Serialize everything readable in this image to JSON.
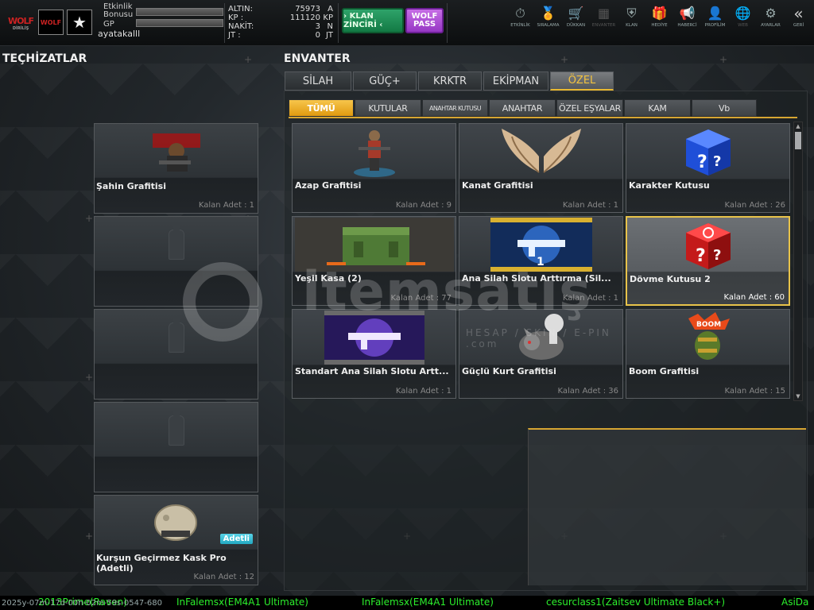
{
  "topbar": {
    "logo_text": "WOLF",
    "logo_sub": "DİRİLİŞ",
    "rank_badge_text": "WOLF",
    "etkinlik_label": "Etkinlik",
    "bonusu_label": "Bonusu",
    "gp_label": "GP",
    "username": "ayatakalll",
    "currency": [
      {
        "label": "ALTIN:",
        "value": "75973",
        "unit": "A"
      },
      {
        "label": "KP   :",
        "value": "111120",
        "unit": "KP"
      },
      {
        "label": "NAKİT:",
        "value": "3",
        "unit": "N"
      },
      {
        "label": "JT   :",
        "value": "0",
        "unit": "JT"
      }
    ],
    "klan_button": "› KLAN ZİNCİRİ ‹",
    "wolf_pass_line1": "WOLF",
    "wolf_pass_line2": "PASS",
    "nav": [
      {
        "label": "ETKİNLİK",
        "icon": "⏱"
      },
      {
        "label": "SIRALAMA",
        "icon": "🏅"
      },
      {
        "label": "DÜKKAN",
        "icon": "🛒"
      },
      {
        "label": "ENVANTER",
        "icon": "▦"
      },
      {
        "label": "KLAN",
        "icon": "⛨"
      },
      {
        "label": "HEDİYE",
        "icon": "🎁"
      },
      {
        "label": "HABERCİ",
        "icon": "📢"
      },
      {
        "label": "PROFİLİM",
        "icon": "👤"
      },
      {
        "label": "WEB",
        "icon": "🌐"
      },
      {
        "label": "AYARLAR",
        "icon": "⚙"
      },
      {
        "label": "GERİ",
        "icon": "«"
      }
    ]
  },
  "left_panel": {
    "title": "TEÇHİZATLAR",
    "slots": [
      {
        "name": "Şahin Grafitisi",
        "count": "Kalan Adet : 1",
        "filled": true
      },
      {
        "name": "",
        "count": "",
        "filled": false
      },
      {
        "name": "",
        "count": "",
        "filled": false
      },
      {
        "name": "",
        "count": "",
        "filled": false
      },
      {
        "name": "Kurşun Geçirmez Kask Pro (Adetli)",
        "count": "Kalan Adet : 12",
        "filled": true,
        "badge": "Adetli"
      }
    ]
  },
  "inventory": {
    "title": "ENVANTER",
    "main_tabs": [
      {
        "label": "SİLAH",
        "active": false
      },
      {
        "label": "GÜÇ+",
        "active": false
      },
      {
        "label": "KRKTR",
        "active": false
      },
      {
        "label": "EKİPMAN",
        "active": false
      },
      {
        "label": "ÖZEL",
        "active": true
      }
    ],
    "sub_tabs": [
      {
        "label": "TÜMÜ",
        "active": true
      },
      {
        "label": "KUTULAR",
        "active": false
      },
      {
        "label": "ANAHTAR KUTUSU",
        "active": false
      },
      {
        "label": "ANAHTAR",
        "active": false
      },
      {
        "label": "ÖZEL EŞYALAR",
        "active": false
      },
      {
        "label": "KAM",
        "active": false
      },
      {
        "label": "Vb",
        "active": false
      }
    ],
    "items": [
      {
        "name": "Azap Grafitisi",
        "count": "Kalan Adet : 9"
      },
      {
        "name": "Kanat Grafitisi",
        "count": "Kalan Adet : 1"
      },
      {
        "name": "Karakter Kutusu",
        "count": "Kalan Adet : 26"
      },
      {
        "name": "Yeşil Kasa (2)",
        "count": "Kalan Adet : 77"
      },
      {
        "name": "Ana Silah Slotu Arttırma (Sil...",
        "count": "Kalan Adet : 1"
      },
      {
        "name": "Dövme Kutusu 2",
        "count": "Kalan Adet : 60"
      },
      {
        "name": "Standart Ana Silah Slotu Artt...",
        "count": "Kalan Adet : 1"
      },
      {
        "name": "Güçlü Kurt Grafitisi",
        "count": "Kalan Adet : 36"
      },
      {
        "name": "Boom Grafitisi",
        "count": "Kalan Adet : 15"
      }
    ],
    "selected_index": 5
  },
  "watermark": {
    "text": "itemsatış",
    "sub": "HESAP / SKIN / E-PIN .com"
  },
  "ticker": {
    "timestamp": "2025y-07m-17d-00h-02m-59s-0547-680",
    "messages": [
      "2013Prime(Raven)",
      "InFalemsx(EM4A1 Ultimate)",
      "InFalemsx(EM4A1 Ultimate)",
      "cesurclass1(Zaitsev Ultimate Black+)",
      "AsiDa"
    ]
  },
  "colors": {
    "accent": "#e8b830",
    "ticker_text": "#2cf02c",
    "klan_green": "#1d8d55",
    "wolf_purple": "#b055d8"
  }
}
